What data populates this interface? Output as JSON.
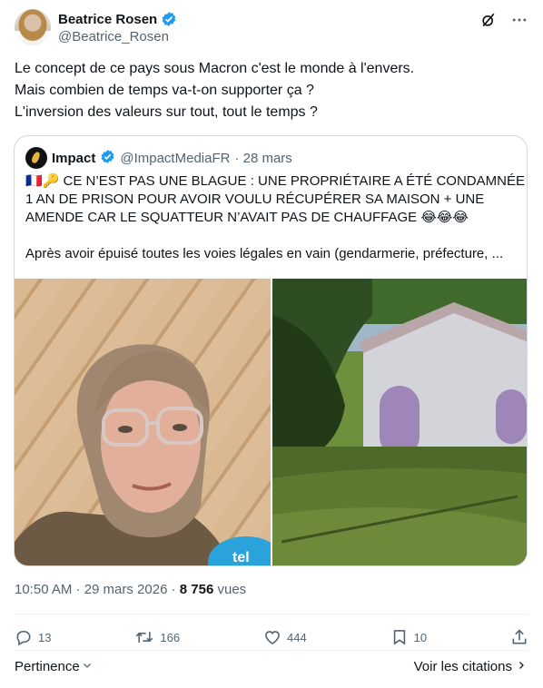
{
  "author": {
    "name": "Beatrice Rosen",
    "handle": "@Beatrice_Rosen"
  },
  "tweet": {
    "lines": [
      "Le concept de ce pays sous Macron c'est le monde à l'envers.",
      "Mais combien de temps va-t-on supporter ça ?",
      "L'inversion des valeurs sur tout, tout le temps ?"
    ]
  },
  "quote": {
    "name": "Impact",
    "handle": "@ImpactMediaFR",
    "date": "· 28 mars",
    "text_lines": [
      "🇫🇷🔑 CE N’EST PAS UNE BLAGUE : UNE PROPRIÉTAIRE A ÉTÉ CONDAMNÉE À",
      "1 AN DE PRISON POUR AVOIR VOULU RÉCUPÉRER SA MAISON + UNE",
      "AMENDE CAR LE SQUATTEUR N’AVAIT PAS DE CHAUFFAGE 😂😂😂"
    ],
    "text_more": "Après avoir épuisé toutes les voies légales en vain (gendarmerie, préfecture, ..."
  },
  "meta": {
    "time_date": "10:50 AM · 29 mars 2026 · ",
    "views_count": "8 756",
    "views_label": " vues"
  },
  "actions": {
    "replies": "13",
    "reposts": "166",
    "likes": "444",
    "bookmarks": "10"
  },
  "footer": {
    "sort_label": "Pertinence",
    "citations_label": "Voir les citations"
  },
  "colors": {
    "verified": "#1d9bf0",
    "secondary_text": "#536471",
    "border": "#cfd9de"
  }
}
